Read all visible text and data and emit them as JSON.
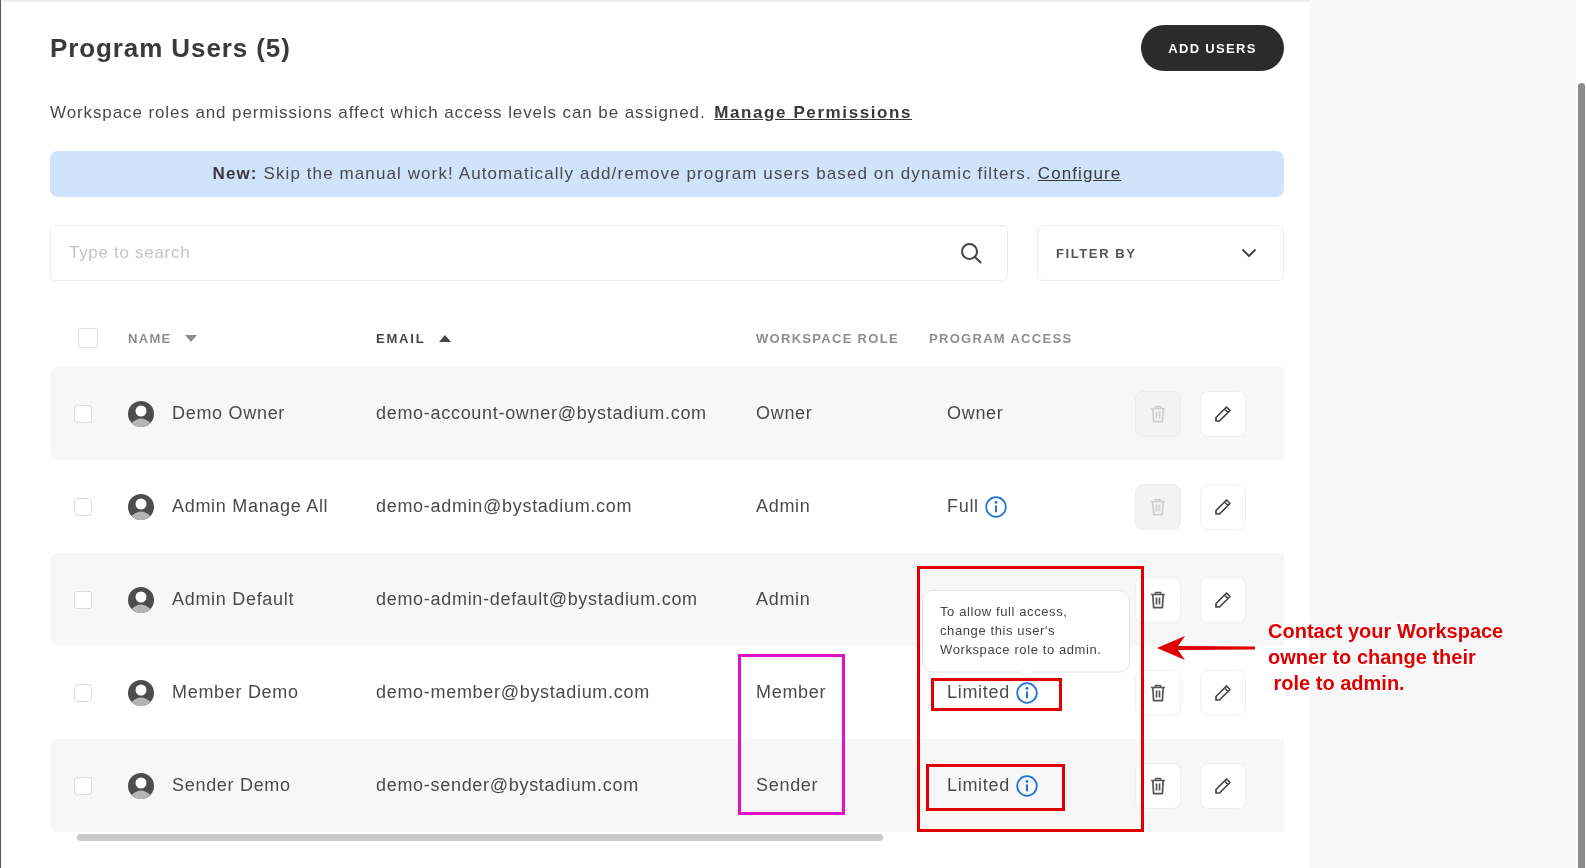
{
  "header": {
    "title": "Program Users (5)",
    "add_button": "ADD USERS"
  },
  "notice": {
    "text": "Workspace roles and permissions affect which access levels can be assigned.",
    "link": "Manage Permissions"
  },
  "banner": {
    "text": "**New:** Skip the manual work! Automatically add/remove program users based on dynamic filters.",
    "link": "Configure"
  },
  "search": {
    "placeholder": "Type to search"
  },
  "filter": {
    "label": "FILTER BY"
  },
  "table": {
    "select_all": {
      "checked": false
    },
    "columns": [
      {
        "label": "NAME",
        "ascending": false,
        "selected": false
      },
      {
        "label": "EMAIL",
        "ascending": true,
        "selected": true
      },
      {
        "label": "WORKSPACE ROLE",
        "selected": false
      },
      {
        "label": "PROGRAM ACCESS",
        "selected": false
      }
    ],
    "rows": [
      {
        "checked": false,
        "name": "Demo Owner",
        "email": "demo-account-owner@bystadium.com",
        "role": "Owner",
        "access": "Owner",
        "access_info": false,
        "delete_disabled": true
      },
      {
        "checked": false,
        "name": "Admin Manage All",
        "email": "demo-admin@bystadium.com",
        "role": "Admin",
        "access": "Full",
        "access_info": true,
        "delete_disabled": true
      },
      {
        "checked": false,
        "name": "Admin Default",
        "email": "demo-admin-default@bystadium.com",
        "role": "Admin",
        "delete_disabled": false
      },
      {
        "checked": false,
        "name": "Member Demo",
        "email": "demo-member@bystadium.com",
        "role": "Member",
        "access": "Limited",
        "access_info": true,
        "delete_disabled": false,
        "tooltip": "To allow full access,\nchange this user's\nWorkspace role to admin."
      },
      {
        "checked": false,
        "name": "Sender Demo",
        "email": "demo-sender@bystadium.com",
        "role": "Sender",
        "access": "Limited",
        "access_info": true,
        "delete_disabled": false
      }
    ]
  },
  "annotations": [
    {
      "kind": "frame",
      "color": "#e00000"
    },
    {
      "kind": "frame",
      "color": "#e010c8"
    },
    {
      "kind": "frame",
      "color": "#e00000"
    },
    {
      "kind": "frame",
      "color": "#e00000"
    },
    {
      "kind": "arrow",
      "color": "#e00000"
    },
    {
      "kind": "note",
      "color": "#e00000",
      "text": "Contact your Workspace\nowner to change their\n role to admin."
    }
  ]
}
